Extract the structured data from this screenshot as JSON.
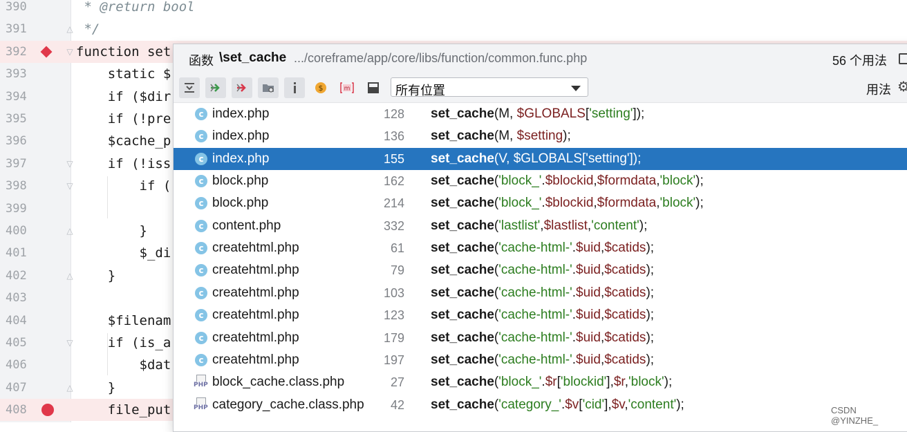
{
  "editor": {
    "lines": [
      {
        "no": "390",
        "code": " * @return bool",
        "doc": true
      },
      {
        "no": "391",
        "code": " */",
        "doc": true
      },
      {
        "no": "392",
        "code": "function set",
        "breakpoint": "diamond",
        "highlight": true
      },
      {
        "no": "393",
        "code": "    static $"
      },
      {
        "no": "394",
        "code": "    if ($dir"
      },
      {
        "no": "395",
        "code": "    if (!pre"
      },
      {
        "no": "396",
        "code": "    $cache_p"
      },
      {
        "no": "397",
        "code": "    if (!iss"
      },
      {
        "no": "398",
        "code": "        if ("
      },
      {
        "no": "399",
        "code": ""
      },
      {
        "no": "400",
        "code": "        }"
      },
      {
        "no": "401",
        "code": "        $_di"
      },
      {
        "no": "402",
        "code": "    }"
      },
      {
        "no": "403",
        "code": ""
      },
      {
        "no": "404",
        "code": "    $filenam"
      },
      {
        "no": "405",
        "code": "    if (is_a"
      },
      {
        "no": "406",
        "code": "        $dat"
      },
      {
        "no": "407",
        "code": "    }"
      },
      {
        "no": "408",
        "code": "    file_put",
        "breakpoint": "circle",
        "highlight": true
      }
    ]
  },
  "popup": {
    "kind": "函数",
    "name": "\\set_cache",
    "path": ".../coreframe/app/core/libs/function/common.func.php",
    "count": "56 个用法",
    "scope": "所有位置",
    "usage_label": "用法",
    "toolbar_icons": [
      "expand-all-icon",
      "navigate-next-icon",
      "navigate-prev-icon",
      "filter-folder-icon",
      "info-icon",
      "dollar-icon",
      "module-icon",
      "preview-icon"
    ]
  },
  "usages": [
    {
      "file": "index.php",
      "icon": "c",
      "line": "128",
      "args": [
        [
          "p",
          "(M, "
        ],
        [
          "v",
          "$GLOBALS"
        ],
        [
          "p",
          "["
        ],
        [
          "s",
          "'setting'"
        ],
        [
          "p",
          "]);"
        ]
      ]
    },
    {
      "file": "index.php",
      "icon": "c",
      "line": "136",
      "args": [
        [
          "p",
          "(M, "
        ],
        [
          "v",
          "$setting"
        ],
        [
          "p",
          ");"
        ]
      ]
    },
    {
      "file": "index.php",
      "icon": "c",
      "line": "155",
      "selected": true,
      "args": [
        [
          "p",
          "(V, "
        ],
        [
          "v",
          "$GLOBALS"
        ],
        [
          "p",
          "["
        ],
        [
          "s",
          "'setting'"
        ],
        [
          "p",
          "]);"
        ]
      ]
    },
    {
      "file": "block.php",
      "icon": "c",
      "line": "162",
      "args": [
        [
          "p",
          "("
        ],
        [
          "s",
          "'block_'"
        ],
        [
          "p",
          "."
        ],
        [
          "v",
          "$blockid"
        ],
        [
          "p",
          ","
        ],
        [
          "v",
          "$formdata"
        ],
        [
          "p",
          ","
        ],
        [
          "s",
          "'block'"
        ],
        [
          "p",
          ");"
        ]
      ]
    },
    {
      "file": "block.php",
      "icon": "c",
      "line": "214",
      "args": [
        [
          "p",
          "("
        ],
        [
          "s",
          "'block_'"
        ],
        [
          "p",
          "."
        ],
        [
          "v",
          "$blockid"
        ],
        [
          "p",
          ","
        ],
        [
          "v",
          "$formdata"
        ],
        [
          "p",
          ","
        ],
        [
          "s",
          "'block'"
        ],
        [
          "p",
          ");"
        ]
      ]
    },
    {
      "file": "content.php",
      "icon": "c",
      "line": "332",
      "args": [
        [
          "p",
          "("
        ],
        [
          "s",
          "'lastlist'"
        ],
        [
          "p",
          ","
        ],
        [
          "v",
          "$lastlist"
        ],
        [
          "p",
          ","
        ],
        [
          "s",
          "'content'"
        ],
        [
          "p",
          ");"
        ]
      ]
    },
    {
      "file": "createhtml.php",
      "icon": "c",
      "line": "61",
      "args": [
        [
          "p",
          "("
        ],
        [
          "s",
          "'cache-html-'"
        ],
        [
          "p",
          "."
        ],
        [
          "v",
          "$uid"
        ],
        [
          "p",
          ","
        ],
        [
          "v",
          "$catids"
        ],
        [
          "p",
          ");"
        ]
      ]
    },
    {
      "file": "createhtml.php",
      "icon": "c",
      "line": "79",
      "args": [
        [
          "p",
          "("
        ],
        [
          "s",
          "'cache-html-'"
        ],
        [
          "p",
          "."
        ],
        [
          "v",
          "$uid"
        ],
        [
          "p",
          ","
        ],
        [
          "v",
          "$catids"
        ],
        [
          "p",
          ");"
        ]
      ]
    },
    {
      "file": "createhtml.php",
      "icon": "c",
      "line": "103",
      "args": [
        [
          "p",
          "("
        ],
        [
          "s",
          "'cache-html-'"
        ],
        [
          "p",
          "."
        ],
        [
          "v",
          "$uid"
        ],
        [
          "p",
          ","
        ],
        [
          "v",
          "$catids"
        ],
        [
          "p",
          ");"
        ]
      ]
    },
    {
      "file": "createhtml.php",
      "icon": "c",
      "line": "123",
      "args": [
        [
          "p",
          "("
        ],
        [
          "s",
          "'cache-html-'"
        ],
        [
          "p",
          "."
        ],
        [
          "v",
          "$uid"
        ],
        [
          "p",
          ","
        ],
        [
          "v",
          "$catids"
        ],
        [
          "p",
          ");"
        ]
      ]
    },
    {
      "file": "createhtml.php",
      "icon": "c",
      "line": "179",
      "args": [
        [
          "p",
          "("
        ],
        [
          "s",
          "'cache-html-'"
        ],
        [
          "p",
          "."
        ],
        [
          "v",
          "$uid"
        ],
        [
          "p",
          ","
        ],
        [
          "v",
          "$catids"
        ],
        [
          "p",
          ");"
        ]
      ]
    },
    {
      "file": "createhtml.php",
      "icon": "c",
      "line": "197",
      "args": [
        [
          "p",
          "("
        ],
        [
          "s",
          "'cache-html-'"
        ],
        [
          "p",
          "."
        ],
        [
          "v",
          "$uid"
        ],
        [
          "p",
          ","
        ],
        [
          "v",
          "$catids"
        ],
        [
          "p",
          ");"
        ]
      ]
    },
    {
      "file": "block_cache.class.php",
      "icon": "php",
      "line": "27",
      "args": [
        [
          "p",
          "("
        ],
        [
          "s",
          "'block_'"
        ],
        [
          "p",
          "."
        ],
        [
          "v",
          "$r"
        ],
        [
          "p",
          "["
        ],
        [
          "s",
          "'blockid'"
        ],
        [
          "p",
          "],"
        ],
        [
          "v",
          "$r"
        ],
        [
          "p",
          ","
        ],
        [
          "s",
          "'block'"
        ],
        [
          "p",
          ");"
        ]
      ]
    },
    {
      "file": "category_cache.class.php",
      "icon": "php",
      "line": "42",
      "args": [
        [
          "p",
          "("
        ],
        [
          "s",
          "'category_'"
        ],
        [
          "p",
          "."
        ],
        [
          "v",
          "$v"
        ],
        [
          "p",
          "["
        ],
        [
          "s",
          "'cid'"
        ],
        [
          "p",
          "],"
        ],
        [
          "v",
          "$v"
        ],
        [
          "p",
          ","
        ],
        [
          "s",
          "'content'"
        ],
        [
          "p",
          ");"
        ]
      ]
    }
  ],
  "func_name": "set_cache",
  "watermark": "CSDN @YINZHE_"
}
